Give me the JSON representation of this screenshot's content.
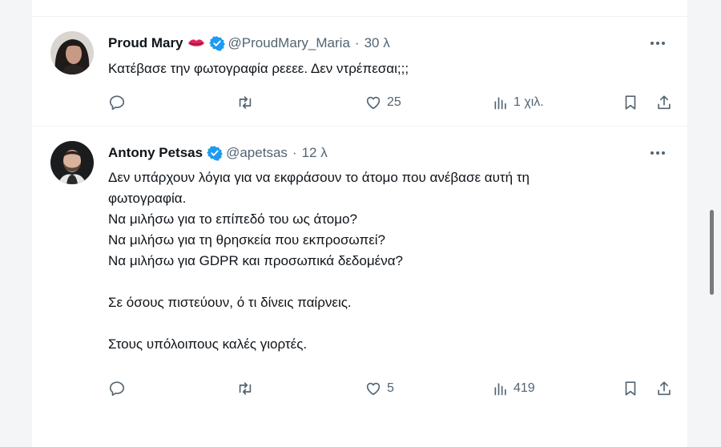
{
  "tweets": [
    {
      "name": "Proud Mary",
      "emoji": "lips",
      "handle": "@ProudMary_Maria",
      "separator": "·",
      "time": "30 λ",
      "text": "Κατέβασε την φωτογραφία ρεεεε. Δεν ντρέπεσαι;;;",
      "replies": "",
      "retweets": "",
      "likes": "25",
      "views": "1 χιλ."
    },
    {
      "name": "Antony Petsas",
      "handle": "@apetsas",
      "separator": "·",
      "time": "12 λ",
      "lines": [
        "Δεν υπάρχουν λόγια για να εκφράσουν το άτομο που ανέβασε αυτή τη",
        "φωτογραφία.",
        "Να μιλήσω για το επίπεδό του ως άτομο?",
        "Να μιλήσω για τη θρησκεία που εκπροσωπεί?",
        "Να μιλήσω για GDPR και προσωπικά δεδομένα?",
        "Σε όσους πιστεύουν, ό τι δίνεις παίρνεις.",
        "Στους υπόλοιπους καλές γιορτές."
      ],
      "replies": "",
      "retweets": "",
      "likes": "5",
      "views": "419"
    }
  ],
  "icons": {
    "verified": "verified-badge-icon",
    "more": "more-options-icon",
    "reply": "reply-icon",
    "retweet": "retweet-icon",
    "like": "heart-icon",
    "views": "views-icon",
    "bookmark": "bookmark-icon",
    "share": "share-icon"
  },
  "colors": {
    "verified": "#1d9bf0",
    "text": "#0f1419",
    "secondary": "#536471",
    "lips": "#e0245e"
  }
}
